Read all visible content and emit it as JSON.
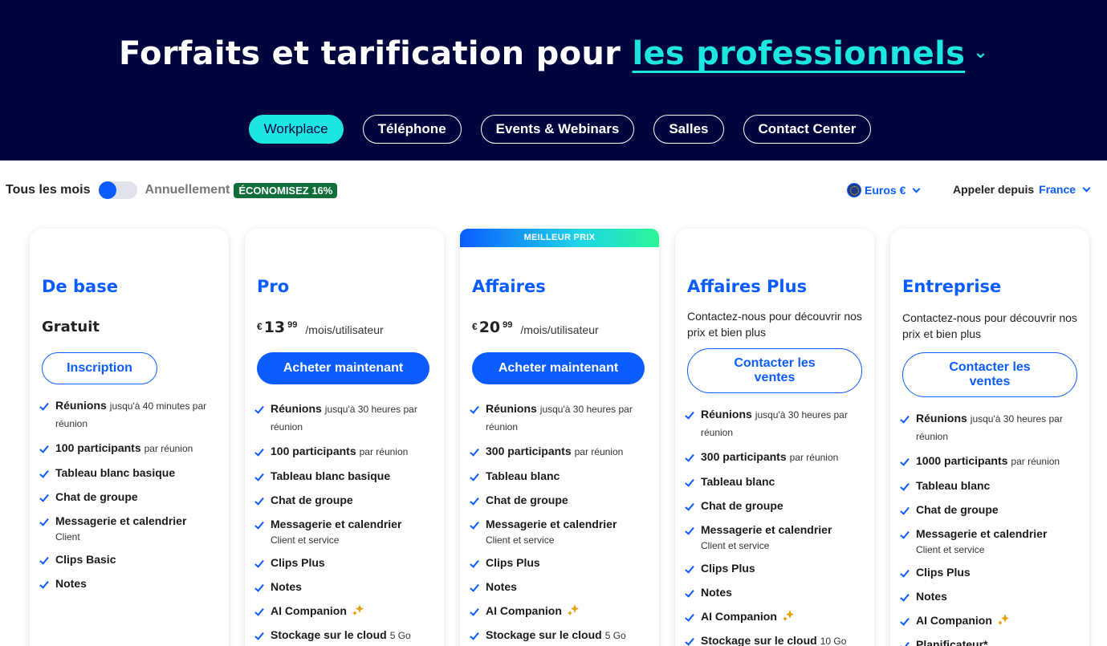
{
  "hero": {
    "title_prefix": "Forfaits et tarification pour",
    "title_accent": "les professionnels",
    "tabs": [
      "Workplace",
      "Téléphone",
      "Events & Webinars",
      "Salles",
      "Contact Center"
    ]
  },
  "billing": {
    "monthly_label": "Tous les mois",
    "annual_label": "Annuellement",
    "save_badge": "ÉCONOMISEZ 16%"
  },
  "currency": {
    "label": "Euros €"
  },
  "call_from": {
    "label": "Appeler depuis",
    "value": "France"
  },
  "colors": {
    "navy": "#00053d",
    "accent": "#1de6e0",
    "blue": "#0b5cff",
    "badge_green": "#0f6e3a"
  },
  "plans": [
    {
      "name": "De base",
      "free_label": "Gratuit",
      "button": "Inscription",
      "features": [
        {
          "name": "Réunions",
          "sub": "jusqu'à 40 minutes par réunion"
        },
        {
          "name": "100 participants",
          "sub": "par réunion"
        },
        {
          "name": "Tableau blanc basique",
          "sub": ""
        },
        {
          "name": "Chat de groupe",
          "sub": ""
        },
        {
          "name": "Messagerie et calendrier",
          "sub": "Client"
        },
        {
          "name": "Clips Basic",
          "sub": ""
        },
        {
          "name": "Notes",
          "sub": ""
        }
      ]
    },
    {
      "name": "Pro",
      "price": {
        "currency": "€",
        "int": "13",
        "dec": "99",
        "per": "/mois/utilisateur"
      },
      "button": "Acheter maintenant",
      "features": [
        {
          "name": "Réunions",
          "sub": "jusqu'à 30 heures par réunion"
        },
        {
          "name": "100 participants",
          "sub": "par réunion"
        },
        {
          "name": "Tableau blanc basique",
          "sub": ""
        },
        {
          "name": "Chat de groupe",
          "sub": ""
        },
        {
          "name": "Messagerie et calendrier",
          "sub": "Client et service"
        },
        {
          "name": "Clips Plus",
          "sub": ""
        },
        {
          "name": "Notes",
          "sub": ""
        },
        {
          "name": "AI Companion",
          "sub": ""
        },
        {
          "name": "Stockage sur le cloud",
          "sub": "5 Go"
        }
      ]
    },
    {
      "name": "Affaires",
      "ribbon": "MEILLEUR PRIX",
      "price": {
        "currency": "€",
        "int": "20",
        "dec": "99",
        "per": "/mois/utilisateur"
      },
      "button": "Acheter maintenant",
      "features": [
        {
          "name": "Réunions",
          "sub": "jusqu'à 30 heures par réunion"
        },
        {
          "name": "300 participants",
          "sub": "par réunion"
        },
        {
          "name": "Tableau blanc",
          "sub": ""
        },
        {
          "name": "Chat de groupe",
          "sub": ""
        },
        {
          "name": "Messagerie et calendrier",
          "sub": "Client et service"
        },
        {
          "name": "Clips Plus",
          "sub": ""
        },
        {
          "name": "Notes",
          "sub": ""
        },
        {
          "name": "AI Companion",
          "sub": ""
        },
        {
          "name": "Stockage sur le cloud",
          "sub": "5 Go"
        }
      ]
    },
    {
      "name": "Affaires Plus",
      "contact_text": "Contactez-nous pour découvrir nos prix et bien plus",
      "button": "Contacter les ventes",
      "features": [
        {
          "name": "Réunions",
          "sub": "jusqu'à 30 heures par réunion"
        },
        {
          "name": "300 participants",
          "sub": "par réunion"
        },
        {
          "name": "Tableau blanc",
          "sub": ""
        },
        {
          "name": "Chat de groupe",
          "sub": ""
        },
        {
          "name": "Messagerie et calendrier",
          "sub": "Client et service"
        },
        {
          "name": "Clips Plus",
          "sub": ""
        },
        {
          "name": "Notes",
          "sub": ""
        },
        {
          "name": "AI Companion",
          "sub": ""
        },
        {
          "name": "Stockage sur le cloud",
          "sub": "10 Go"
        }
      ]
    },
    {
      "name": "Entreprise",
      "contact_text": "Contactez-nous pour découvrir nos prix et bien plus",
      "button": "Contacter les ventes",
      "features": [
        {
          "name": "Réunions",
          "sub": "jusqu'à 30 heures par réunion"
        },
        {
          "name": "1000 participants",
          "sub": "par réunion"
        },
        {
          "name": "Tableau blanc",
          "sub": ""
        },
        {
          "name": "Chat de groupe",
          "sub": ""
        },
        {
          "name": "Messagerie et calendrier",
          "sub": "Client et service"
        },
        {
          "name": "Clips Plus",
          "sub": ""
        },
        {
          "name": "Notes",
          "sub": ""
        },
        {
          "name": "AI Companion",
          "sub": ""
        },
        {
          "name": "Planificateur*",
          "sub": ""
        }
      ]
    }
  ]
}
